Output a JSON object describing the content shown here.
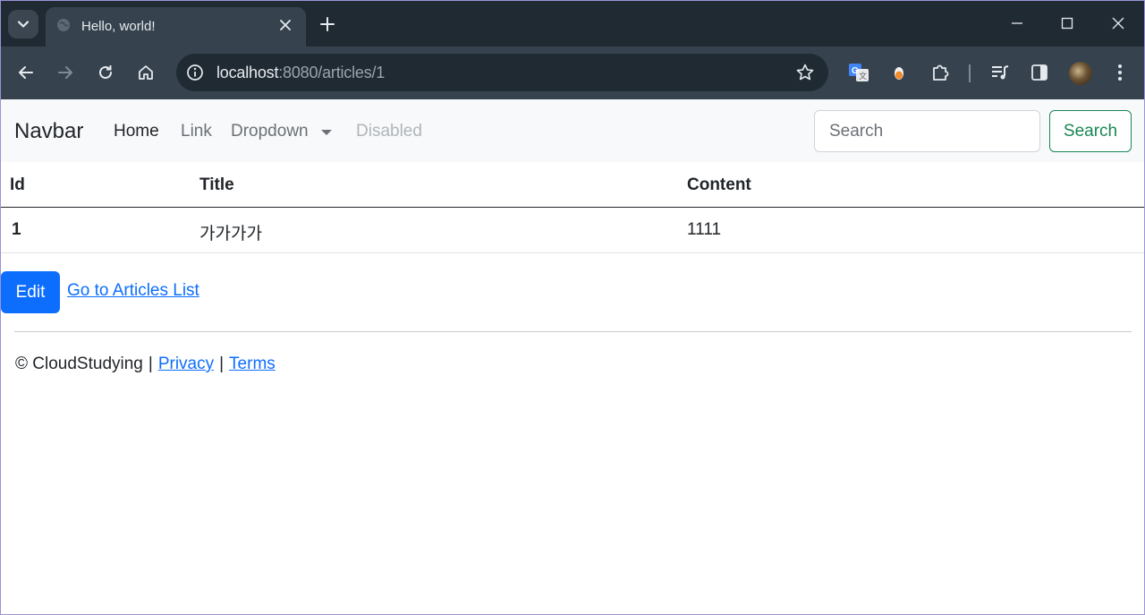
{
  "browser": {
    "tab_title": "Hello, world!",
    "url_host": "localhost",
    "url_path": ":8080/articles/1"
  },
  "navbar": {
    "brand": "Navbar",
    "links": [
      "Home",
      "Link",
      "Dropdown",
      "Disabled"
    ],
    "search_placeholder": "Search",
    "search_button": "Search"
  },
  "table": {
    "headers": [
      "Id",
      "Title",
      "Content"
    ],
    "rows": [
      [
        "1",
        "가가가가",
        "1111"
      ]
    ]
  },
  "actions": {
    "edit_label": "Edit",
    "list_link": "Go to Articles List"
  },
  "footer": {
    "copyright": "© CloudStudying",
    "sep": "|",
    "privacy": "Privacy",
    "terms": "Terms"
  },
  "colors": {
    "primary": "#0d6efd",
    "success": "#198754",
    "navbar_bg": "#f8f9fa",
    "chrome_dark": "#202a33",
    "chrome_toolbar": "#36434e"
  }
}
